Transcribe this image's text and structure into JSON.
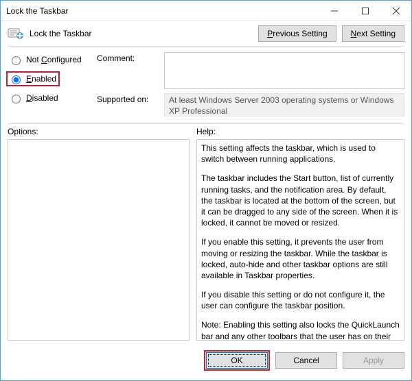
{
  "window": {
    "title": "Lock the Taskbar"
  },
  "toolbar": {
    "policy_title": "Lock the Taskbar",
    "previous_label": "Previous Setting",
    "next_label": "Next Setting"
  },
  "config": {
    "radios": {
      "not_configured": "Not Configured",
      "enabled": "Enabled",
      "disabled": "Disabled"
    },
    "selected": "enabled",
    "comment_label": "Comment:",
    "comment_value": "",
    "supported_label": "Supported on:",
    "supported_value": "At least Windows Server 2003 operating systems or Windows XP Professional"
  },
  "options": {
    "label": "Options:"
  },
  "help": {
    "label": "Help:",
    "paragraphs": [
      "This setting affects the taskbar, which is used to switch between running applications.",
      "The taskbar includes the Start button, list of currently running tasks, and the notification area. By default, the taskbar is located at the bottom of the screen, but it can be dragged to any side of the screen. When it is locked, it cannot be moved or resized.",
      "If you enable this setting, it prevents the user from moving or resizing the taskbar. While the taskbar is locked, auto-hide and other taskbar options are still available in Taskbar properties.",
      "If you disable this setting or do not configure it, the user can configure the taskbar position.",
      "Note: Enabling this setting also locks the QuickLaunch bar and any other toolbars that the user has on their taskbar. The toolbar's position is locked, and the user cannot show and hide various toolbars using the taskbar context menu."
    ]
  },
  "footer": {
    "ok": "OK",
    "cancel": "Cancel",
    "apply": "Apply"
  }
}
